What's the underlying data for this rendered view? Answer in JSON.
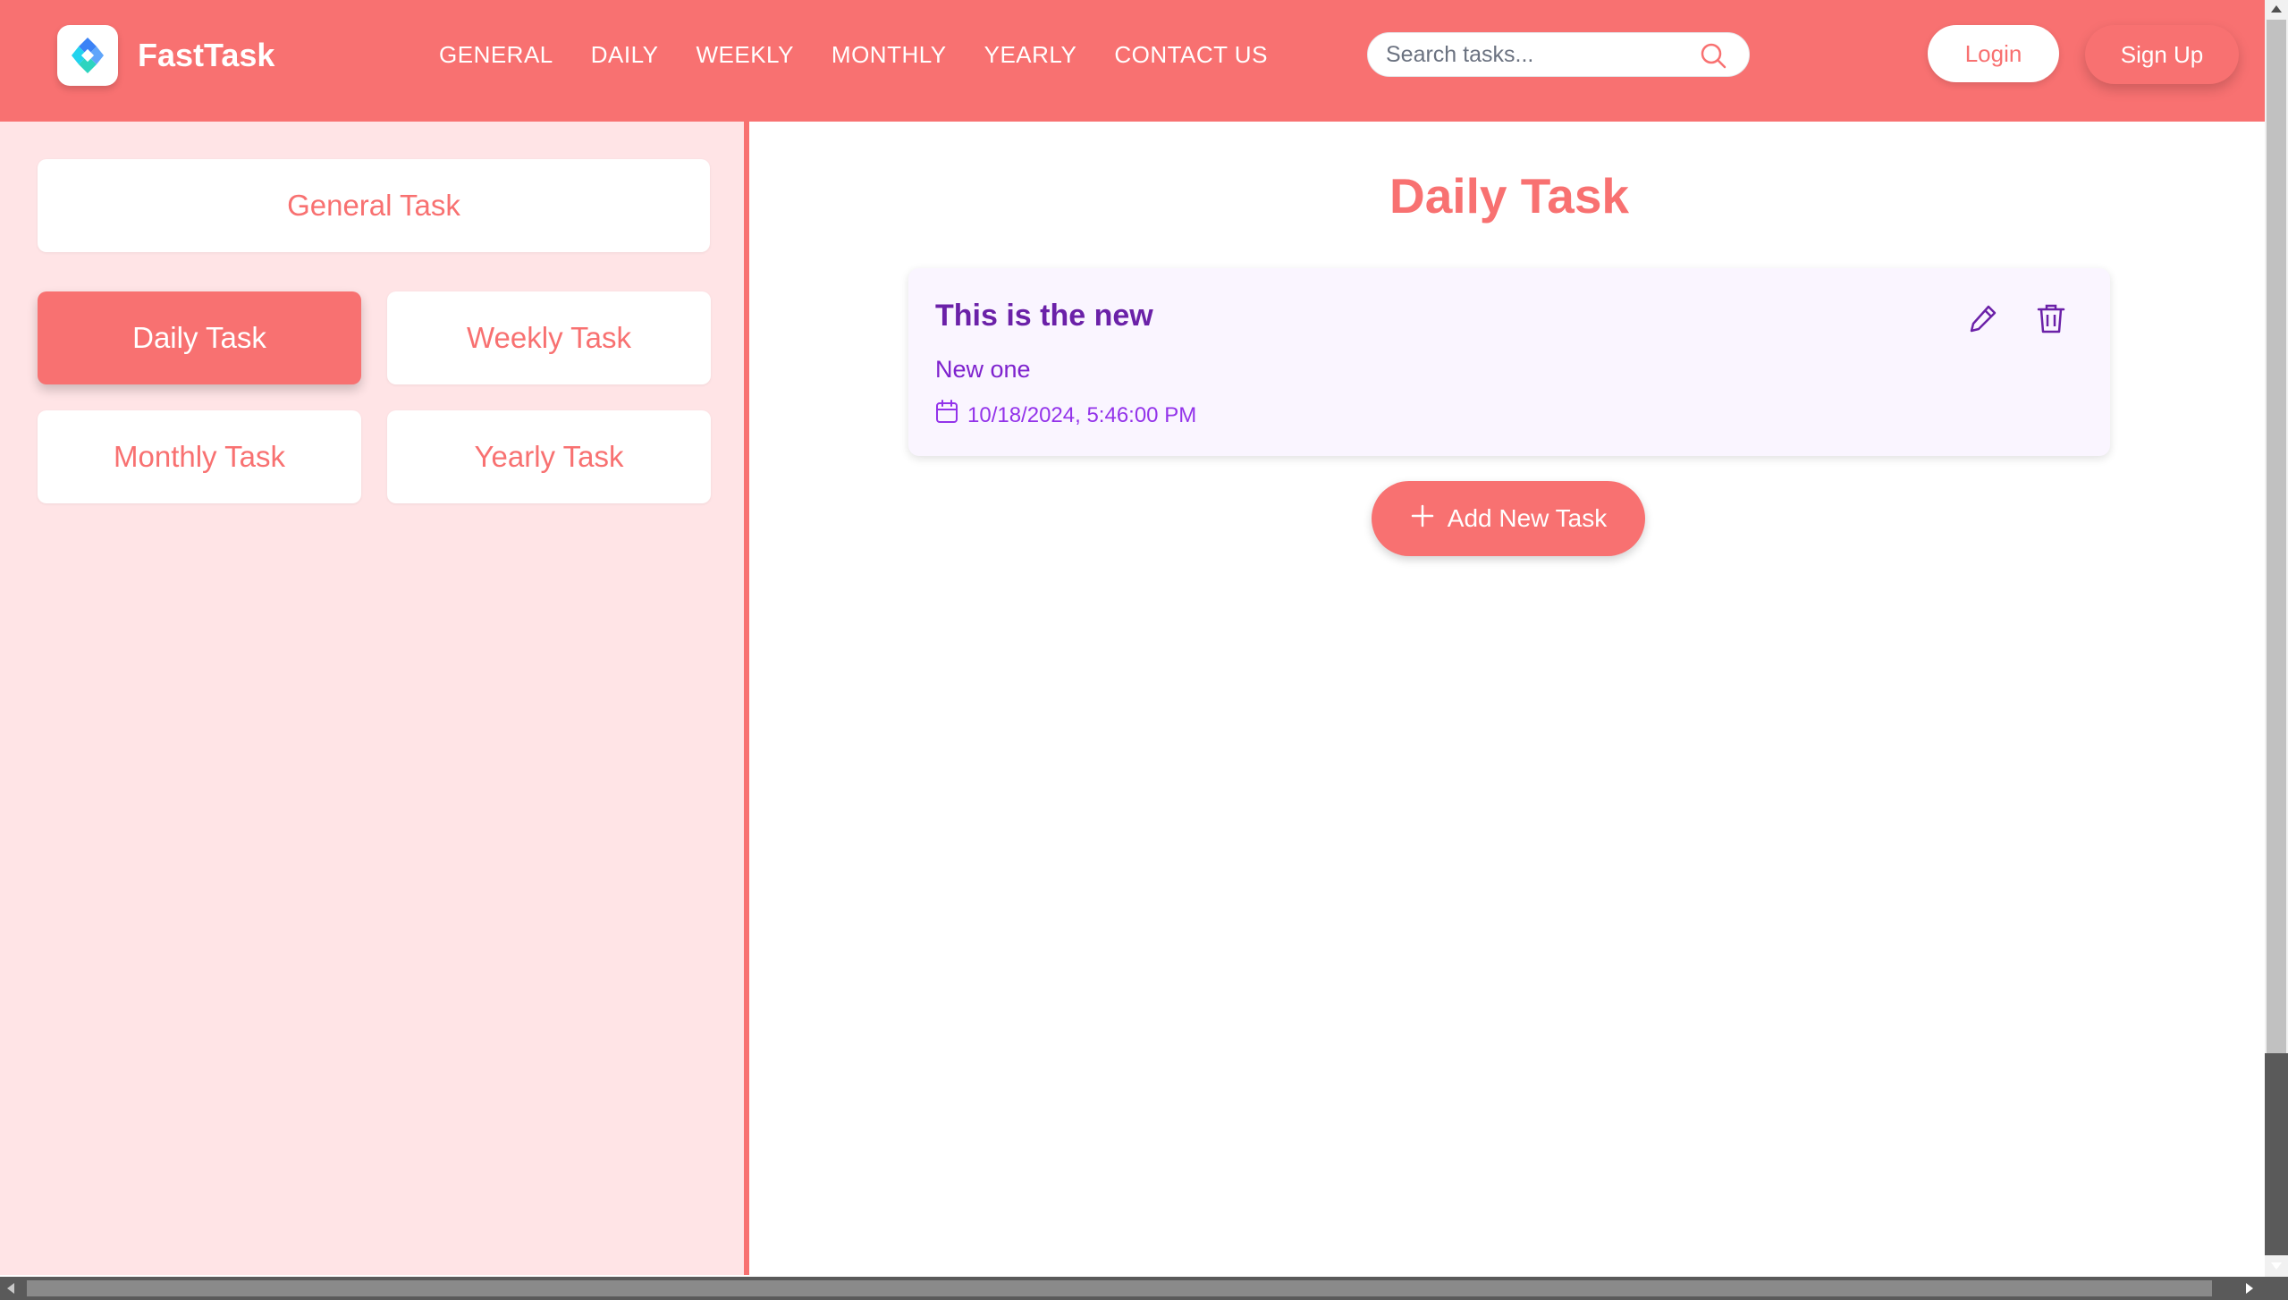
{
  "header": {
    "brand": "FastTask",
    "nav": [
      "GENERAL",
      "DAILY",
      "WEEKLY",
      "MONTHLY",
      "YEARLY",
      "CONTACT US"
    ],
    "search_placeholder": "Search tasks...",
    "login_label": "Login",
    "signup_label": "Sign Up"
  },
  "sidebar": {
    "general_label": "General Task",
    "daily_label": "Daily Task",
    "weekly_label": "Weekly Task",
    "monthly_label": "Monthly Task",
    "yearly_label": "Yearly Task",
    "active": "Daily Task"
  },
  "main": {
    "title": "Daily Task",
    "tasks": [
      {
        "title": "This is the new",
        "description": "New one",
        "date": "10/18/2024, 5:46:00 PM"
      }
    ],
    "add_label": "Add New Task"
  },
  "colors": {
    "primary": "#f87171",
    "sidebar_bg": "#ffe4e6",
    "card_bg": "#faf5ff",
    "card_text": "#6b21a8"
  },
  "icons": [
    "logo-icon",
    "search-icon",
    "calendar-icon",
    "edit-icon",
    "trash-icon",
    "plus-icon"
  ]
}
